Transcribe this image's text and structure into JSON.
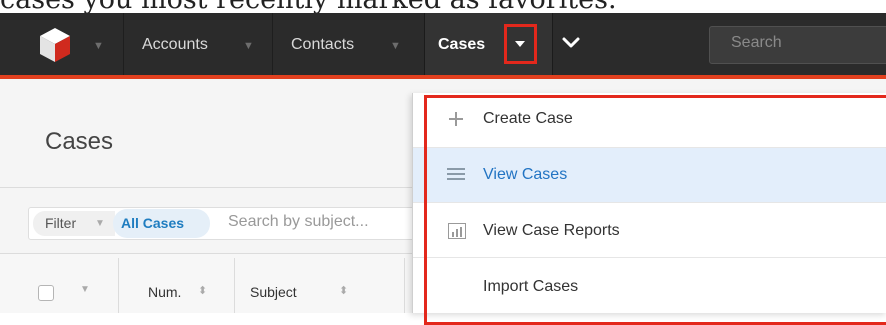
{
  "caption": "cases you most recently marked as favorites.",
  "navbar": {
    "modules": [
      "Accounts",
      "Contacts"
    ],
    "active_module": "Cases",
    "search_placeholder": "Search"
  },
  "page": {
    "title": "Cases",
    "filter_label": "Filter",
    "filter_value": "All Cases",
    "search_placeholder": "Search by subject...",
    "columns": [
      "Num.",
      "Subject"
    ]
  },
  "dropdown": {
    "items": [
      {
        "label": "Create Case",
        "icon": "plus-icon"
      },
      {
        "label": "View Cases",
        "icon": "list-icon",
        "highlighted": true
      },
      {
        "label": "View Case Reports",
        "icon": "bar-chart-icon"
      },
      {
        "label": "Import Cases",
        "icon": ""
      }
    ]
  },
  "colors": {
    "navbar": "#2b2b2b",
    "accent_red": "#e3281c",
    "link_blue": "#2274c3",
    "highlight": "#e3eefb"
  }
}
